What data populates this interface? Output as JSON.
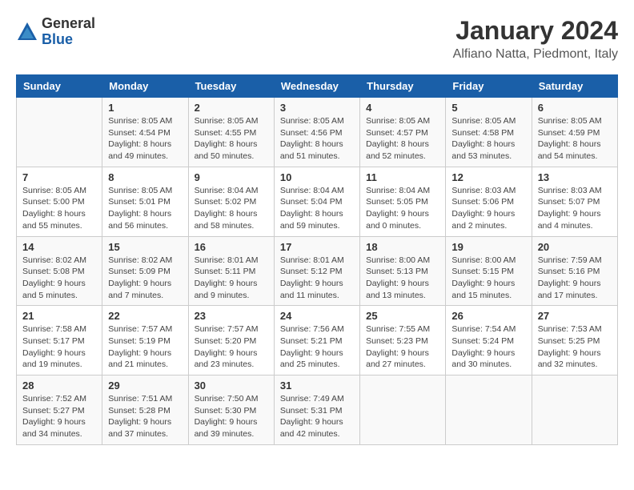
{
  "header": {
    "logo": {
      "general": "General",
      "blue": "Blue"
    },
    "title": "January 2024",
    "subtitle": "Alfiano Natta, Piedmont, Italy"
  },
  "weekdays": [
    "Sunday",
    "Monday",
    "Tuesday",
    "Wednesday",
    "Thursday",
    "Friday",
    "Saturday"
  ],
  "weeks": [
    [
      {
        "day": null
      },
      {
        "day": "1",
        "sunrise": "Sunrise: 8:05 AM",
        "sunset": "Sunset: 4:54 PM",
        "daylight": "Daylight: 8 hours and 49 minutes."
      },
      {
        "day": "2",
        "sunrise": "Sunrise: 8:05 AM",
        "sunset": "Sunset: 4:55 PM",
        "daylight": "Daylight: 8 hours and 50 minutes."
      },
      {
        "day": "3",
        "sunrise": "Sunrise: 8:05 AM",
        "sunset": "Sunset: 4:56 PM",
        "daylight": "Daylight: 8 hours and 51 minutes."
      },
      {
        "day": "4",
        "sunrise": "Sunrise: 8:05 AM",
        "sunset": "Sunset: 4:57 PM",
        "daylight": "Daylight: 8 hours and 52 minutes."
      },
      {
        "day": "5",
        "sunrise": "Sunrise: 8:05 AM",
        "sunset": "Sunset: 4:58 PM",
        "daylight": "Daylight: 8 hours and 53 minutes."
      },
      {
        "day": "6",
        "sunrise": "Sunrise: 8:05 AM",
        "sunset": "Sunset: 4:59 PM",
        "daylight": "Daylight: 8 hours and 54 minutes."
      }
    ],
    [
      {
        "day": "7",
        "sunrise": "Sunrise: 8:05 AM",
        "sunset": "Sunset: 5:00 PM",
        "daylight": "Daylight: 8 hours and 55 minutes."
      },
      {
        "day": "8",
        "sunrise": "Sunrise: 8:05 AM",
        "sunset": "Sunset: 5:01 PM",
        "daylight": "Daylight: 8 hours and 56 minutes."
      },
      {
        "day": "9",
        "sunrise": "Sunrise: 8:04 AM",
        "sunset": "Sunset: 5:02 PM",
        "daylight": "Daylight: 8 hours and 58 minutes."
      },
      {
        "day": "10",
        "sunrise": "Sunrise: 8:04 AM",
        "sunset": "Sunset: 5:04 PM",
        "daylight": "Daylight: 8 hours and 59 minutes."
      },
      {
        "day": "11",
        "sunrise": "Sunrise: 8:04 AM",
        "sunset": "Sunset: 5:05 PM",
        "daylight": "Daylight: 9 hours and 0 minutes."
      },
      {
        "day": "12",
        "sunrise": "Sunrise: 8:03 AM",
        "sunset": "Sunset: 5:06 PM",
        "daylight": "Daylight: 9 hours and 2 minutes."
      },
      {
        "day": "13",
        "sunrise": "Sunrise: 8:03 AM",
        "sunset": "Sunset: 5:07 PM",
        "daylight": "Daylight: 9 hours and 4 minutes."
      }
    ],
    [
      {
        "day": "14",
        "sunrise": "Sunrise: 8:02 AM",
        "sunset": "Sunset: 5:08 PM",
        "daylight": "Daylight: 9 hours and 5 minutes."
      },
      {
        "day": "15",
        "sunrise": "Sunrise: 8:02 AM",
        "sunset": "Sunset: 5:09 PM",
        "daylight": "Daylight: 9 hours and 7 minutes."
      },
      {
        "day": "16",
        "sunrise": "Sunrise: 8:01 AM",
        "sunset": "Sunset: 5:11 PM",
        "daylight": "Daylight: 9 hours and 9 minutes."
      },
      {
        "day": "17",
        "sunrise": "Sunrise: 8:01 AM",
        "sunset": "Sunset: 5:12 PM",
        "daylight": "Daylight: 9 hours and 11 minutes."
      },
      {
        "day": "18",
        "sunrise": "Sunrise: 8:00 AM",
        "sunset": "Sunset: 5:13 PM",
        "daylight": "Daylight: 9 hours and 13 minutes."
      },
      {
        "day": "19",
        "sunrise": "Sunrise: 8:00 AM",
        "sunset": "Sunset: 5:15 PM",
        "daylight": "Daylight: 9 hours and 15 minutes."
      },
      {
        "day": "20",
        "sunrise": "Sunrise: 7:59 AM",
        "sunset": "Sunset: 5:16 PM",
        "daylight": "Daylight: 9 hours and 17 minutes."
      }
    ],
    [
      {
        "day": "21",
        "sunrise": "Sunrise: 7:58 AM",
        "sunset": "Sunset: 5:17 PM",
        "daylight": "Daylight: 9 hours and 19 minutes."
      },
      {
        "day": "22",
        "sunrise": "Sunrise: 7:57 AM",
        "sunset": "Sunset: 5:19 PM",
        "daylight": "Daylight: 9 hours and 21 minutes."
      },
      {
        "day": "23",
        "sunrise": "Sunrise: 7:57 AM",
        "sunset": "Sunset: 5:20 PM",
        "daylight": "Daylight: 9 hours and 23 minutes."
      },
      {
        "day": "24",
        "sunrise": "Sunrise: 7:56 AM",
        "sunset": "Sunset: 5:21 PM",
        "daylight": "Daylight: 9 hours and 25 minutes."
      },
      {
        "day": "25",
        "sunrise": "Sunrise: 7:55 AM",
        "sunset": "Sunset: 5:23 PM",
        "daylight": "Daylight: 9 hours and 27 minutes."
      },
      {
        "day": "26",
        "sunrise": "Sunrise: 7:54 AM",
        "sunset": "Sunset: 5:24 PM",
        "daylight": "Daylight: 9 hours and 30 minutes."
      },
      {
        "day": "27",
        "sunrise": "Sunrise: 7:53 AM",
        "sunset": "Sunset: 5:25 PM",
        "daylight": "Daylight: 9 hours and 32 minutes."
      }
    ],
    [
      {
        "day": "28",
        "sunrise": "Sunrise: 7:52 AM",
        "sunset": "Sunset: 5:27 PM",
        "daylight": "Daylight: 9 hours and 34 minutes."
      },
      {
        "day": "29",
        "sunrise": "Sunrise: 7:51 AM",
        "sunset": "Sunset: 5:28 PM",
        "daylight": "Daylight: 9 hours and 37 minutes."
      },
      {
        "day": "30",
        "sunrise": "Sunrise: 7:50 AM",
        "sunset": "Sunset: 5:30 PM",
        "daylight": "Daylight: 9 hours and 39 minutes."
      },
      {
        "day": "31",
        "sunrise": "Sunrise: 7:49 AM",
        "sunset": "Sunset: 5:31 PM",
        "daylight": "Daylight: 9 hours and 42 minutes."
      },
      {
        "day": null
      },
      {
        "day": null
      },
      {
        "day": null
      }
    ]
  ]
}
